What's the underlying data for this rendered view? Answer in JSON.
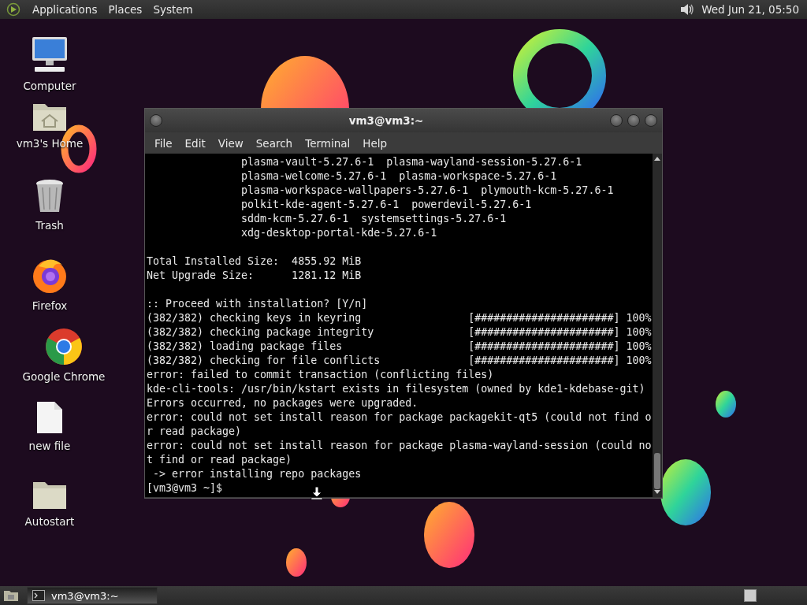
{
  "top_panel": {
    "menus": [
      "Applications",
      "Places",
      "System"
    ],
    "clock": "Wed Jun 21, 05:50"
  },
  "desktop_icons": [
    {
      "label": "Computer",
      "kind": "computer"
    },
    {
      "label": "vm3's Home",
      "kind": "home"
    },
    {
      "label": "Trash",
      "kind": "trash"
    },
    {
      "label": "Firefox",
      "kind": "firefox"
    },
    {
      "label": "Google Chrome",
      "kind": "chrome"
    },
    {
      "label": "new file",
      "kind": "file"
    },
    {
      "label": "Autostart",
      "kind": "folder"
    }
  ],
  "terminal": {
    "title": "vm3@vm3:~",
    "menu": [
      "File",
      "Edit",
      "View",
      "Search",
      "Terminal",
      "Help"
    ],
    "paragraphs": [
      [
        "               plasma-vault-5.27.6-1  plasma-wayland-session-5.27.6-1",
        "               plasma-welcome-5.27.6-1  plasma-workspace-5.27.6-1",
        "               plasma-workspace-wallpapers-5.27.6-1  plymouth-kcm-5.27.6-1",
        "               polkit-kde-agent-5.27.6-1  powerdevil-5.27.6-1",
        "               sddm-kcm-5.27.6-1  systemsettings-5.27.6-1",
        "               xdg-desktop-portal-kde-5.27.6-1"
      ],
      [
        "Total Installed Size:  4855.92 MiB",
        "Net Upgrade Size:      1281.12 MiB"
      ],
      [
        ":: Proceed with installation? [Y/n]",
        "(382/382) checking keys in keyring                 [######################] 100%",
        "(382/382) checking package integrity               [######################] 100%",
        "(382/382) loading package files                    [######################] 100%",
        "(382/382) checking for file conflicts              [######################] 100%",
        "error: failed to commit transaction (conflicting files)",
        "kde-cli-tools: /usr/bin/kstart exists in filesystem (owned by kde1-kdebase-git)",
        "Errors occurred, no packages were upgraded.",
        "error: could not set install reason for package packagekit-qt5 (could not find o",
        "r read package)",
        "error: could not set install reason for package plasma-wayland-session (could no",
        "t find or read package)",
        " -> error installing repo packages"
      ]
    ],
    "prompt": "[vm3@vm3 ~]$"
  },
  "taskbar": {
    "tasks": [
      {
        "label": "vm3@vm3:~",
        "selected": true
      }
    ]
  }
}
